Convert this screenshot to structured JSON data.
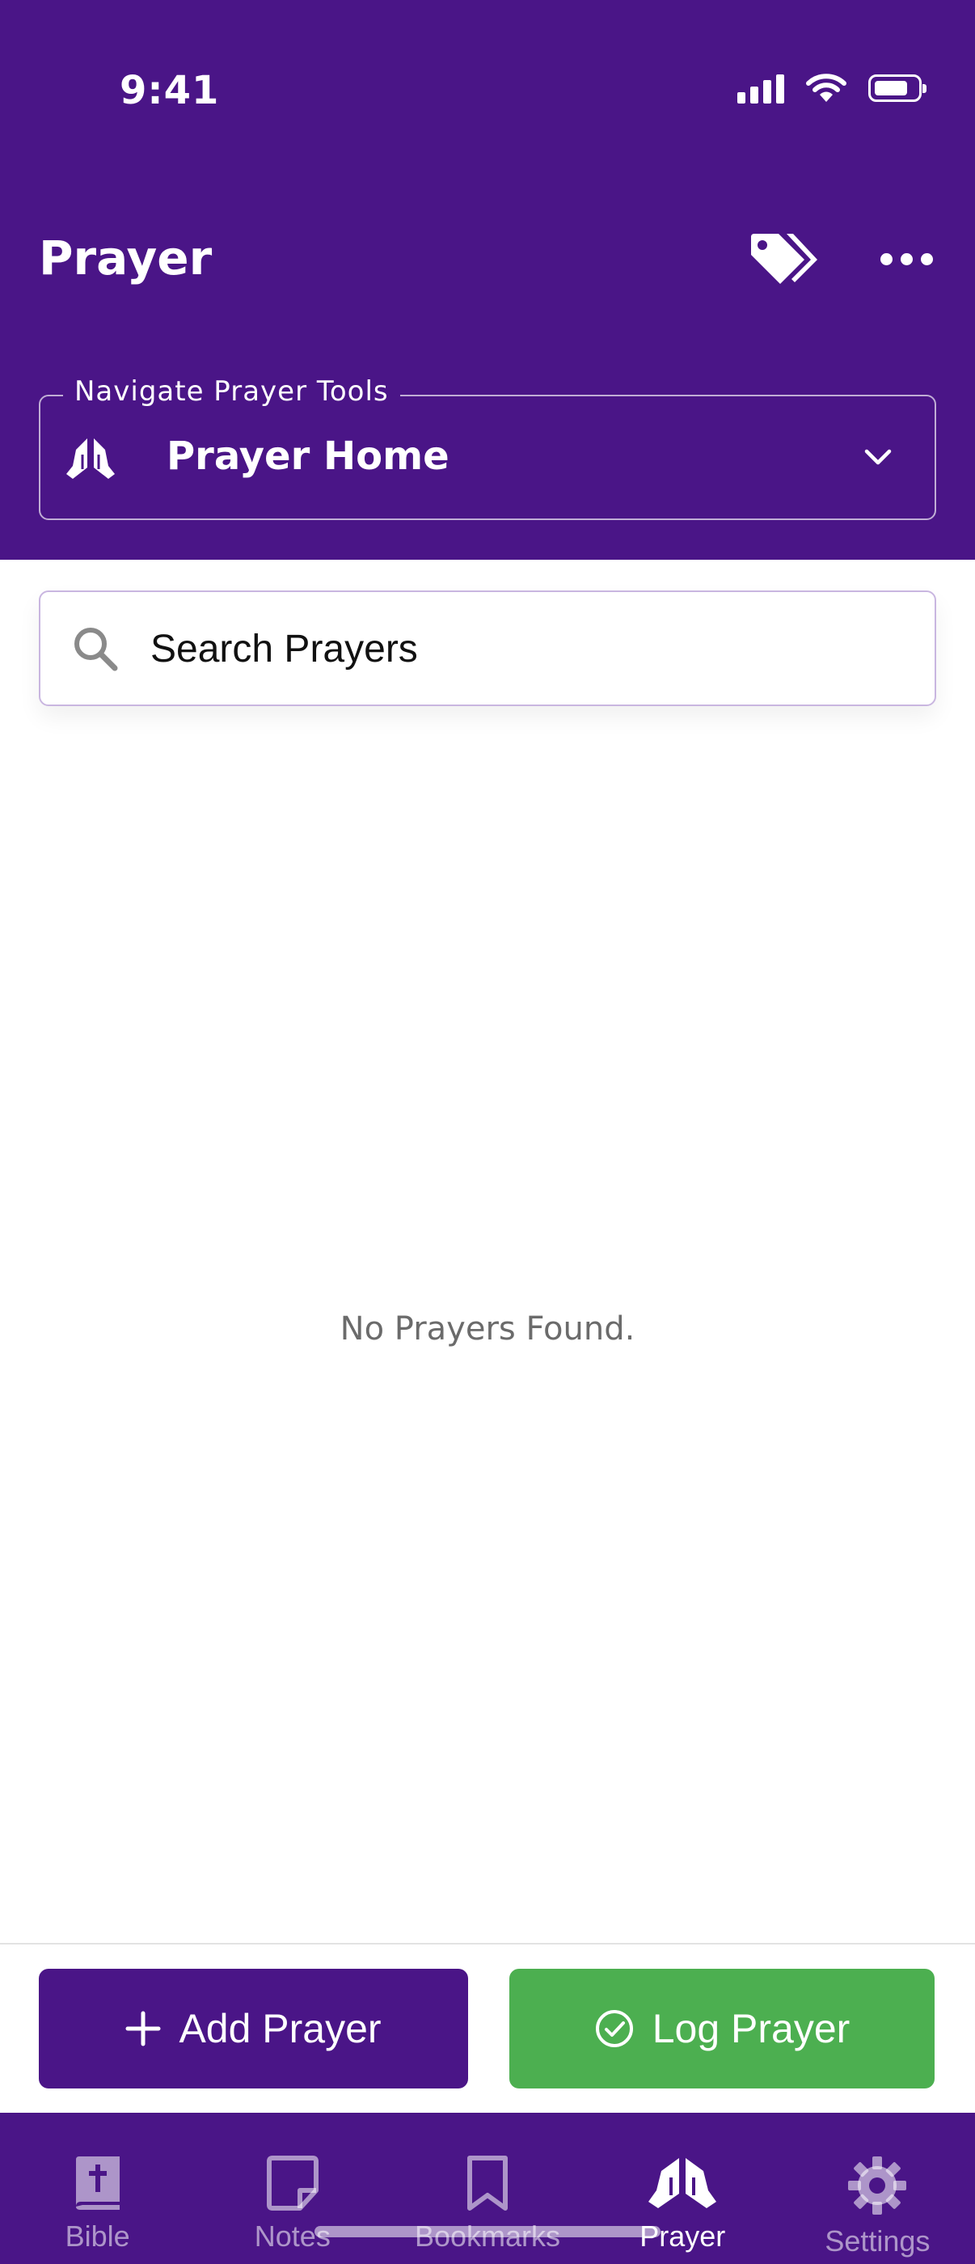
{
  "status_bar": {
    "time": "9:41",
    "icons": [
      "signal-icon",
      "wifi-icon",
      "battery-icon"
    ]
  },
  "header": {
    "title": "Prayer",
    "actions": [
      "tags-icon",
      "more-icon"
    ],
    "background_color": "#4a1587"
  },
  "navigate": {
    "legend": "Navigate Prayer Tools",
    "selected": "Prayer Home",
    "icon": "praying-hands-icon"
  },
  "search": {
    "placeholder": "Search Prayers",
    "value": ""
  },
  "empty_state": {
    "message": "No Prayers Found."
  },
  "actions": {
    "add_label": "Add Prayer",
    "add_icon": "plus-icon",
    "add_color": "#4a1587",
    "log_label": "Log Prayer",
    "log_icon": "check-circle-icon",
    "log_color": "#4caf50"
  },
  "tabbar": {
    "items": [
      {
        "label": "Bible",
        "icon": "bible-icon",
        "active": false
      },
      {
        "label": "Notes",
        "icon": "note-icon",
        "active": false
      },
      {
        "label": "Bookmarks",
        "icon": "bookmark-icon",
        "active": false
      },
      {
        "label": "Prayer",
        "icon": "praying-hands-icon",
        "active": true
      },
      {
        "label": "Settings",
        "icon": "gear-icon",
        "active": false
      }
    ]
  }
}
